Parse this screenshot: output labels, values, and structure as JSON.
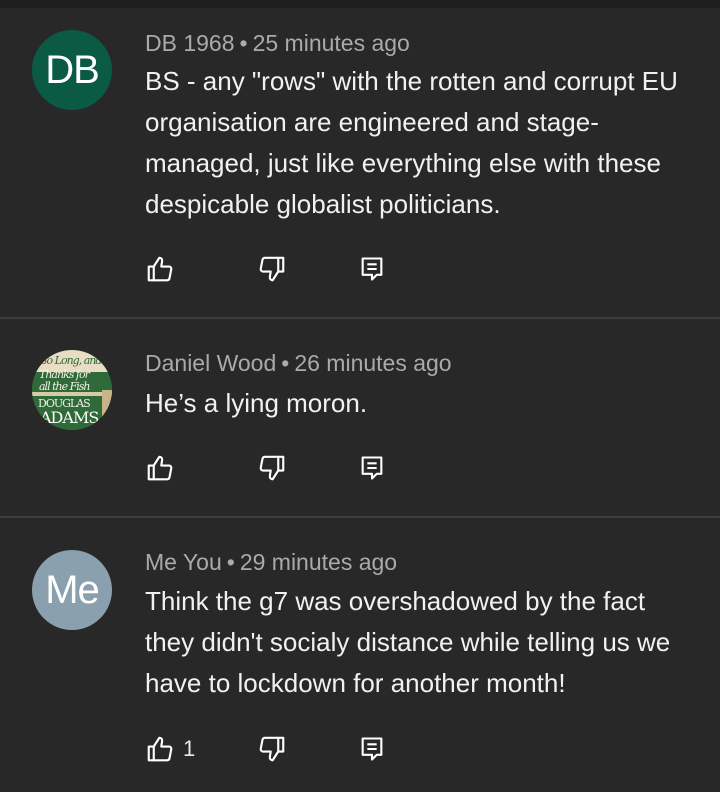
{
  "comments": [
    {
      "author": "DB 1968",
      "time": "25 minutes ago",
      "text": "BS - any \"rows\" with the rotten and corrupt EU organisation are engineered and stage-managed, just like everything else with these despicable globalist politicians.",
      "avatar_initials": "DB",
      "avatar_color": "#0b5a43",
      "likes": ""
    },
    {
      "author": "Daniel Wood",
      "time": "26 minutes ago",
      "text": "He’s a lying moron.",
      "avatar_image_text": [
        "So Long, and",
        "Thanks for",
        "all the Fish",
        "DOUGLAS",
        "ADAMS"
      ],
      "likes": ""
    },
    {
      "author": "Me You",
      "time": "29 minutes ago",
      "text": "Think the g7 was overshadowed by the fact they didn't socialy distance while telling us we have to lockdown for another month!",
      "avatar_initials": "Me",
      "avatar_color": "#8aa0ae",
      "likes": "1"
    }
  ],
  "meta_separator": "•",
  "icons": {
    "like": "thumbs-up-icon",
    "dislike": "thumbs-down-icon",
    "reply": "reply-icon"
  },
  "colors": {
    "background": "#282828",
    "meta_text": "#aaaaaa",
    "body_text": "#f1f1f1",
    "divider": "#3d3d3d"
  }
}
